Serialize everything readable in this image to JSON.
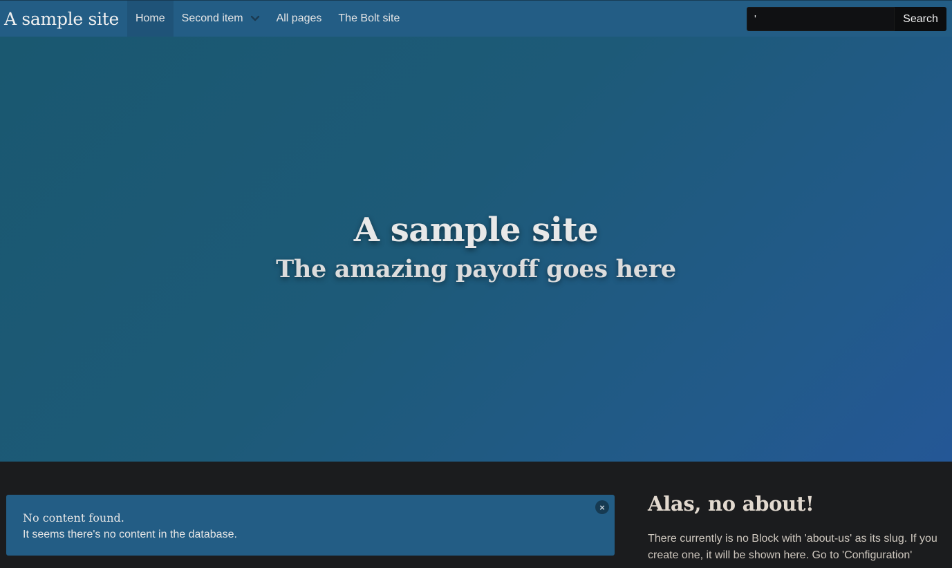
{
  "nav": {
    "brand": "A sample site",
    "items": [
      {
        "label": "Home"
      },
      {
        "label": "Second item"
      },
      {
        "label": "All pages"
      },
      {
        "label": "The Bolt site"
      }
    ],
    "search_value": "'",
    "search_button": "Search"
  },
  "hero": {
    "title": "A sample site",
    "subtitle": "The amazing payoff goes here"
  },
  "alert": {
    "title": "No content found.",
    "text": "It seems there's no content in the database.",
    "close_glyph": "×"
  },
  "aside": {
    "title": "Alas, no about!",
    "text": "There currently is no Block with 'about-us' as its slug. If you create one, it will be shown here. Go to 'Configuration'"
  },
  "colors": {
    "navbar": "#235d85",
    "hero_start": "#1a5870",
    "hero_end": "#245796",
    "page_bg": "#1b1c1e"
  }
}
